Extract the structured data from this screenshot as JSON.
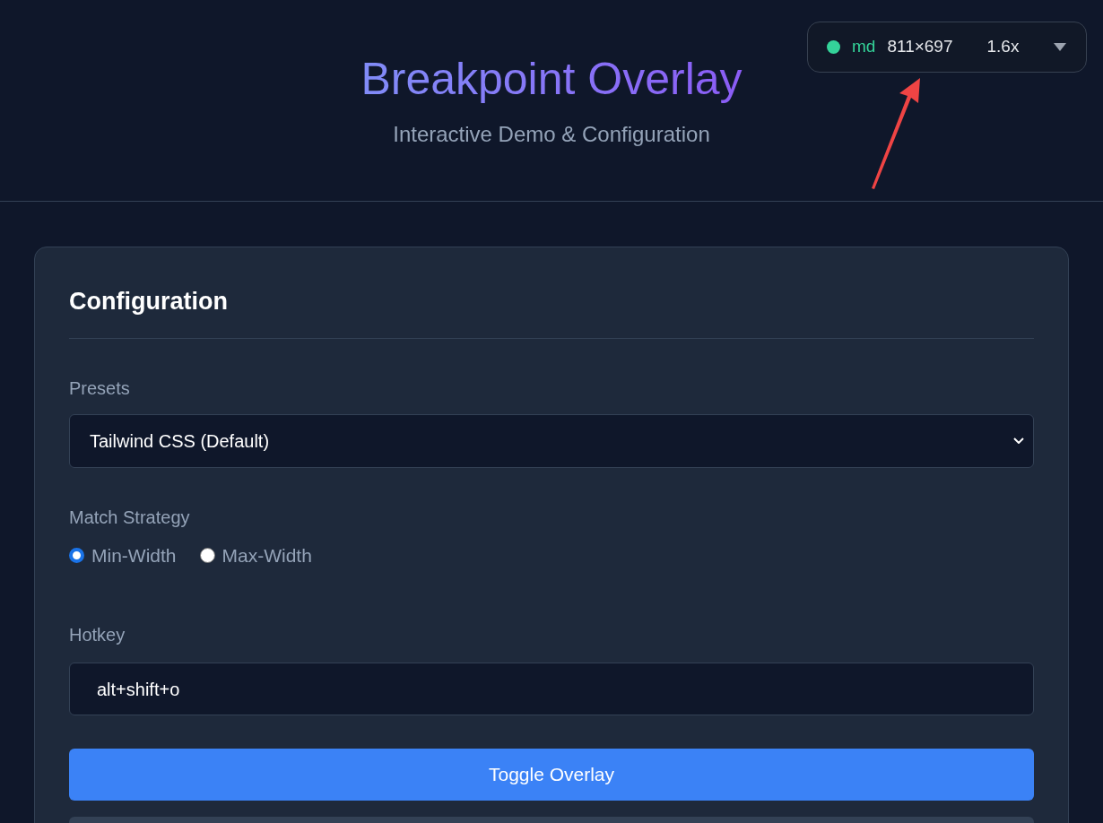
{
  "header": {
    "title": "Breakpoint Overlay",
    "subtitle": "Interactive Demo & Configuration"
  },
  "overlay_badge": {
    "color": "#34d399",
    "breakpoint": "md",
    "size": "811×697",
    "scale": "1.6x"
  },
  "configuration": {
    "title": "Configuration",
    "presets": {
      "label": "Presets",
      "value": "Tailwind CSS (Default)"
    },
    "match_strategy": {
      "label": "Match Strategy",
      "options": [
        {
          "label": "Min-Width",
          "selected": true
        },
        {
          "label": "Max-Width",
          "selected": false
        }
      ]
    },
    "hotkey": {
      "label": "Hotkey",
      "value": "alt+shift+o"
    },
    "toggle_button": "Toggle Overlay"
  }
}
